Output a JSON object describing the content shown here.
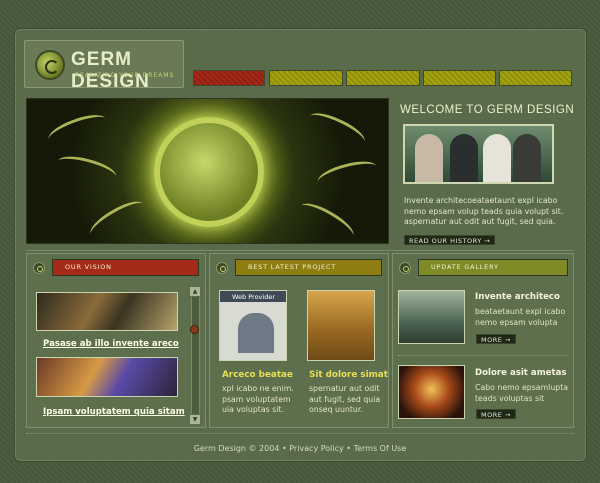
{
  "brand": {
    "title": "GERM DESIGN",
    "tagline": "REALIZING YOUR DREAMS"
  },
  "nav": {
    "tabs": [
      "",
      "",
      "",
      "",
      ""
    ],
    "active_index": 0
  },
  "welcome": {
    "title": "WELCOME TO GERM DESIGN",
    "text": "Invente architecoeataetaunt expl icabo nemo epsam volup teads quia volupt sit. aspernatur aut odit aut fugit, sed quia.",
    "button": "READ OUR HISTORY →"
  },
  "vision": {
    "heading": "OUR VISION",
    "items": [
      {
        "label": "Pasase ab illo invente areco"
      },
      {
        "label": "Ipsam voluptatem quia sitam"
      }
    ]
  },
  "projects": {
    "heading": "BEST LATEST PROJECT",
    "thumb_label": "Web Provider",
    "items": [
      {
        "title": "Arceco beatae",
        "text": "xpl icabo ne enim. psam voluptatem uia voluptas sit."
      },
      {
        "title": "Sit dolore simat",
        "text": "spernatur aut odit aut fugit, sed quia onseq uuntur."
      }
    ]
  },
  "gallery": {
    "heading": "UPDATE GALLERY",
    "items": [
      {
        "title": "Invente architeco",
        "text": "beataetaunt expl icabo nemo epsam volupta",
        "button": "MORE →"
      },
      {
        "title": "Dolore asit ametas",
        "text": "Cabo nemo epsamlupta teads voluptas sit",
        "button": "MORE →"
      }
    ]
  },
  "footer": {
    "copyright": "Germ Design © 2004",
    "sep": "•",
    "privacy": "Privacy Policy",
    "terms": "Terms Of Use"
  },
  "colors": {
    "background": "#4a5a3e",
    "panel": "#5e6f4e",
    "accent_red": "#a8281a",
    "accent_olive": "#a6a50f",
    "accent_green": "#7e8b27",
    "text_light": "#e2e8c7"
  }
}
